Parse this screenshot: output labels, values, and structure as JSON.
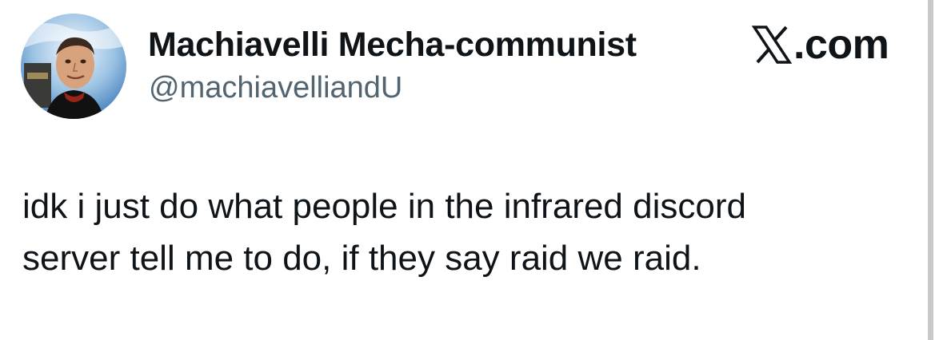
{
  "author": {
    "display_name": "Machiavelli Mecha-communist",
    "handle": "@machiavelliandU",
    "avatar_icon": "avatar-portrait-icon"
  },
  "brand": {
    "text": ".com",
    "logo_icon": "x-logo-icon"
  },
  "tweet": {
    "lines": [
      "idk i just do what people in the infrared discord",
      "server tell me to do, if they say raid we raid."
    ]
  },
  "colors": {
    "text_primary": "#0f1419",
    "text_secondary": "#536471",
    "background": "#ffffff"
  }
}
